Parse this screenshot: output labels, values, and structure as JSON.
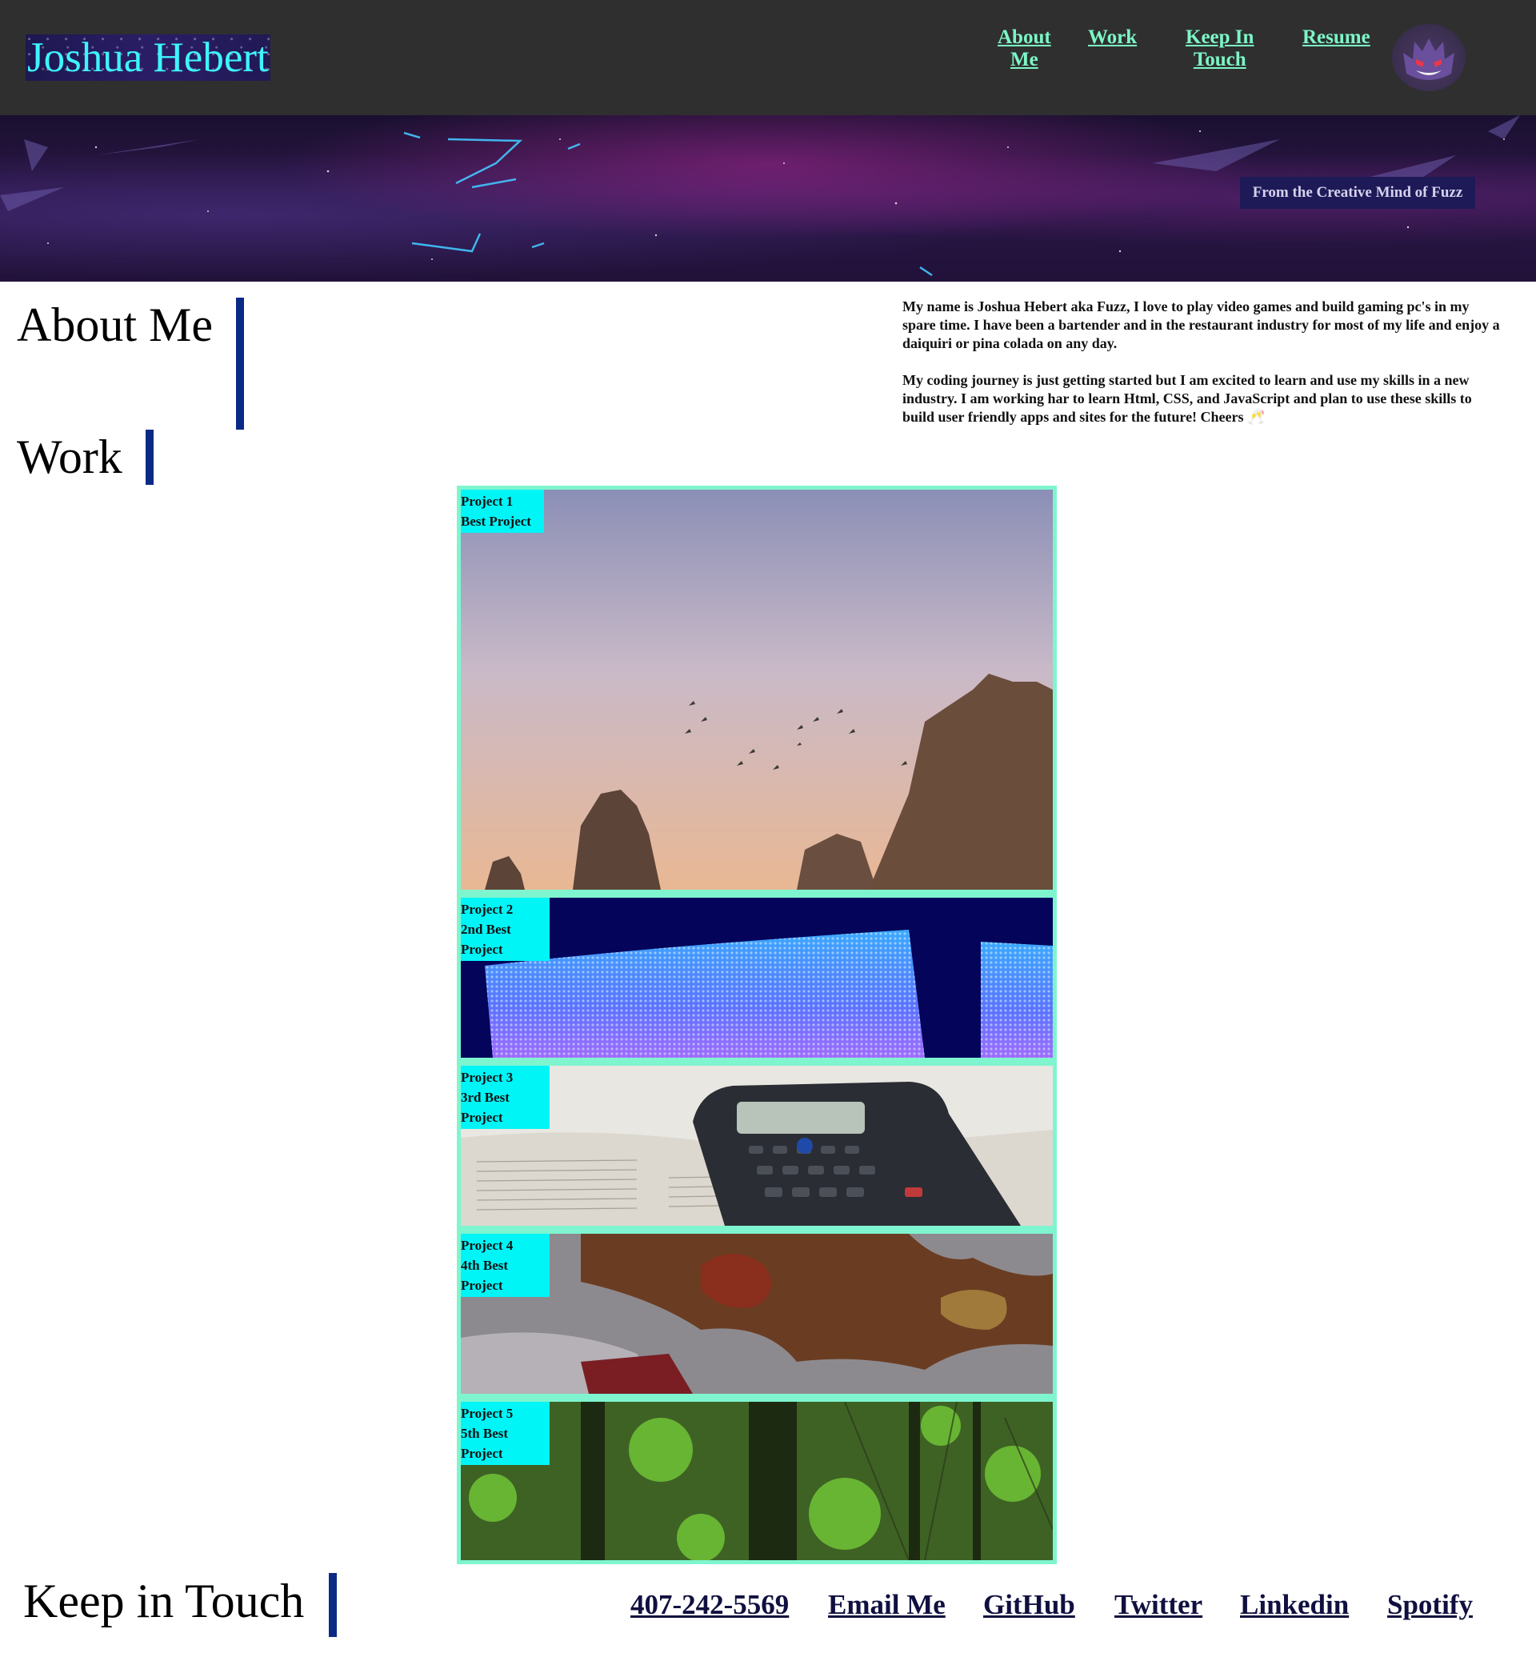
{
  "header": {
    "site_title": "Joshua Hebert",
    "nav": [
      {
        "line1": "About",
        "line2": "Me"
      },
      {
        "line1": "Work",
        "line2": ""
      },
      {
        "line1": "Keep In",
        "line2": "Touch"
      },
      {
        "line1": "Resume",
        "line2": ""
      }
    ],
    "avatar_icon": "gengar-avatar-icon"
  },
  "banner": {
    "tagline": "From the Creative Mind of Fuzz"
  },
  "about": {
    "heading": "About Me",
    "paragraph1": "My name is Joshua Hebert aka Fuzz, I love to play video games and build gaming pc's in my spare time. I have been a bartender and in the restaurant industry for most of my life and enjoy a daiquiri or pina colada on any day.",
    "paragraph2": "My coding journey is just getting started but I am excited to learn and use my skills in a new industry. I am working har to learn Html, CSS, and JavaScript and plan to use these skills to build user friendly apps and sites for the future! Cheers 🥂"
  },
  "work": {
    "heading": "Work",
    "projects": [
      {
        "title": "Project 1",
        "subtitle1": "Best Project",
        "subtitle2": "",
        "image": "rocks-sunset-birds"
      },
      {
        "title": "Project 2",
        "subtitle1": "2nd Best",
        "subtitle2": "Project",
        "image": "blue-led-screen"
      },
      {
        "title": "Project 3",
        "subtitle1": "3rd Best",
        "subtitle2": "Project",
        "image": "calculator-on-book"
      },
      {
        "title": "Project 4",
        "subtitle1": "4th Best",
        "subtitle2": "Project",
        "image": "puzzle-pieces"
      },
      {
        "title": "Project 5",
        "subtitle1": "5th Best",
        "subtitle2": "Project",
        "image": "green-forest"
      }
    ]
  },
  "contact": {
    "heading": "Keep in Touch",
    "links": [
      "407-242-5569",
      "Email Me",
      "GitHub",
      "Twitter",
      "Linkedin",
      "Spotify"
    ]
  },
  "colors": {
    "header_bg": "#2f2f30",
    "nav_link": "#7cf7c6",
    "title_text": "#3ef4ff",
    "accent_bar": "#0b2a86",
    "gallery_border": "#7ff5cf",
    "project_label_bg": "#00f5f7"
  }
}
